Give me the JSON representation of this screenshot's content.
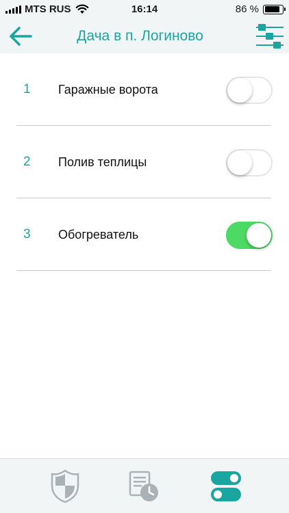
{
  "status_bar": {
    "carrier": "MTS RUS",
    "time": "16:14",
    "battery_percent": "86 %",
    "battery_level": 0.86,
    "icons": [
      "signal-icon",
      "wifi-icon",
      "battery-icon"
    ]
  },
  "header": {
    "title": "Дача в п. Логиново",
    "back_icon": "arrow-left-icon",
    "settings_icon": "sliders-icon"
  },
  "devices": [
    {
      "number": "1",
      "name": "Гаражные ворота",
      "enabled": false
    },
    {
      "number": "2",
      "name": "Полив теплицы",
      "enabled": false
    },
    {
      "number": "3",
      "name": "Обогреватель",
      "enabled": true
    }
  ],
  "tabbar": {
    "tabs": [
      {
        "icon": "shield-icon",
        "active": false
      },
      {
        "icon": "schedule-clock-icon",
        "active": false
      },
      {
        "icon": "toggles-icon",
        "active": true
      }
    ]
  },
  "colors": {
    "accent": "#1ba5a0",
    "toggle_on": "#4cd964",
    "inactive_icon": "#a9b2b6",
    "bar_background": "#f1f5f6"
  }
}
